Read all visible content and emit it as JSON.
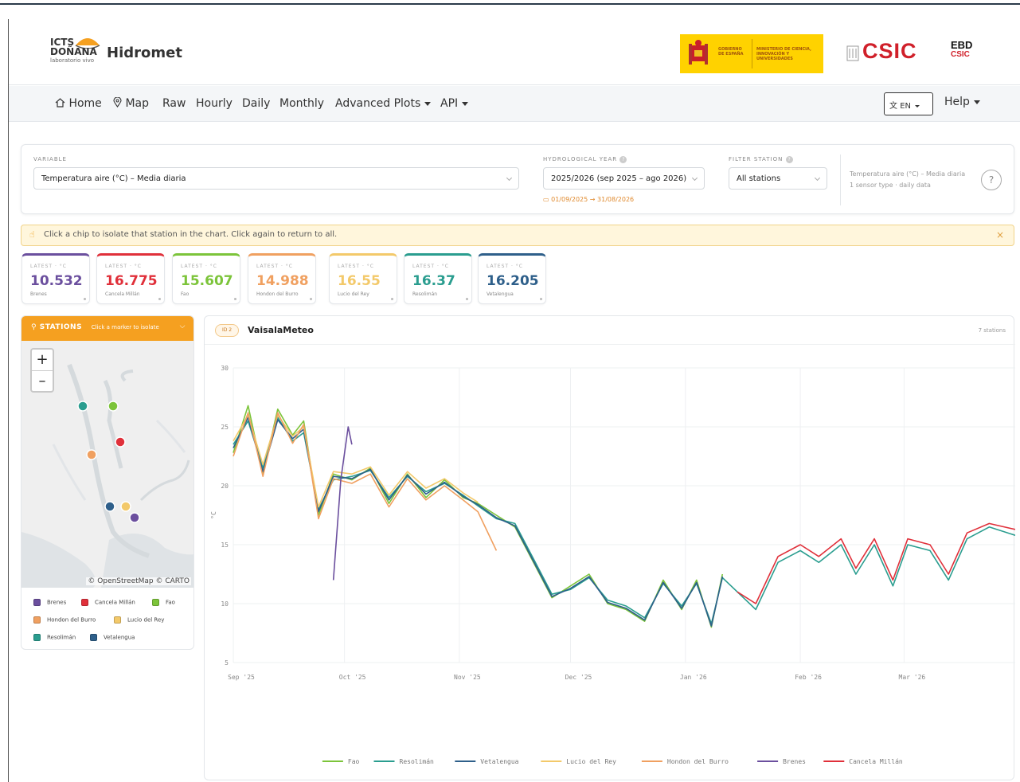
{
  "header": {
    "logo_line1": "ICTS",
    "logo_line2": "DOÑANA",
    "logo_sub": "laboratorio vivo",
    "app_title": "Hidromet",
    "gov_left": "GOBIERNO DE ESPAÑA",
    "gov_right": "MINISTERIO DE CIENCIA, INNOVACIÓN Y UNIVERSIDADES",
    "csic": "CSIC",
    "ebd": "EBD",
    "ebd_sub": "CSIC"
  },
  "nav": {
    "home": "Home",
    "map": "Map",
    "raw": "Raw",
    "hourly": "Hourly",
    "daily": "Daily",
    "monthly": "Monthly",
    "advanced": "Advanced Plots",
    "api": "API",
    "lang": "EN",
    "help": "Help"
  },
  "filters": {
    "variable_label": "VARIABLE",
    "variable_value": "Temperatura aire (°C) – Media diaria",
    "hydro_label": "HYDROLOGICAL YEAR",
    "hydro_value": "2025/2026 (sep 2025 – ago 2026)",
    "date_range": "01/09/2025 → 31/08/2026",
    "station_label": "FILTER STATION",
    "station_value": "All stations",
    "info_line1": "Temperatura aire (°C) – Media diaria",
    "info_line2": "1 sensor type · daily data",
    "info_icon": "?"
  },
  "hint": {
    "text": "Click a chip to isolate that station in the chart. Click again to return to all.",
    "close": "×"
  },
  "chips": [
    {
      "label": "LATEST · °C",
      "value": "10.532",
      "name": "Brenes",
      "color": "#6b4f9e"
    },
    {
      "label": "LATEST · °C",
      "value": "16.775",
      "name": "Cancela Millán",
      "color": "#e0303a"
    },
    {
      "label": "LATEST · °C",
      "value": "15.607",
      "name": "Fao",
      "color": "#7cc43a"
    },
    {
      "label": "LATEST · °C",
      "value": "14.988",
      "name": "Hondon del Burro",
      "color": "#f0a060"
    },
    {
      "label": "LATEST · °C",
      "value": "16.55",
      "name": "Lucio del Rey",
      "color": "#f3c96a"
    },
    {
      "label": "LATEST · °C",
      "value": "16.37",
      "name": "Resolimán",
      "color": "#2a9d8f"
    },
    {
      "label": "LATEST · °C",
      "value": "16.205",
      "name": "Vetalengua",
      "color": "#2e5f8a"
    }
  ],
  "stations_panel": {
    "title": "STATIONS",
    "subtitle": "Click a marker to isolate",
    "zoom_in": "+",
    "zoom_out": "–",
    "attribution": "© OpenStreetMap © CARTO",
    "legend": [
      {
        "name": "Brenes",
        "color": "#6b4f9e"
      },
      {
        "name": "Cancela Millán",
        "color": "#e0303a"
      },
      {
        "name": "Fao",
        "color": "#7cc43a"
      },
      {
        "name": "Hondon del Burro",
        "color": "#f0a060"
      },
      {
        "name": "Lucio del Rey",
        "color": "#f3c96a"
      },
      {
        "name": "Resolimán",
        "color": "#2a9d8f"
      },
      {
        "name": "Vetalengua",
        "color": "#2e5f8a"
      }
    ]
  },
  "chart_panel": {
    "badge": "ID 2",
    "title": "VaisalaMeteo",
    "count": "7 stations"
  },
  "chart_data": {
    "type": "line",
    "ylabel": "°C",
    "ylim": [
      5,
      30
    ],
    "yticks": [
      5,
      10,
      15,
      20,
      25,
      30
    ],
    "x_range": [
      "2025-09-01",
      "2026-03-31"
    ],
    "xticks": [
      {
        "date": "2025-09-01",
        "label": "Sep '25"
      },
      {
        "date": "2025-10-01",
        "label": "Oct '25"
      },
      {
        "date": "2025-11-01",
        "label": "Nov '25"
      },
      {
        "date": "2025-12-01",
        "label": "Dec '25"
      },
      {
        "date": "2026-01-01",
        "label": "Jan '26"
      },
      {
        "date": "2026-02-01",
        "label": "Feb '26"
      },
      {
        "date": "2026-03-01",
        "label": "Mar '26"
      }
    ],
    "legend_position": "bottom",
    "grid": true,
    "series": [
      {
        "name": "Fao",
        "color": "#7cc43a",
        "points": [
          [
            "2025-09-01",
            22.8
          ],
          [
            "2025-09-05",
            26.8
          ],
          [
            "2025-09-09",
            21.0
          ],
          [
            "2025-09-13",
            26.5
          ],
          [
            "2025-09-17",
            24.3
          ],
          [
            "2025-09-20",
            25.5
          ],
          [
            "2025-09-24",
            17.5
          ],
          [
            "2025-09-28",
            21.0
          ],
          [
            "2025-10-03",
            20.5
          ],
          [
            "2025-10-08",
            21.5
          ],
          [
            "2025-10-13",
            18.5
          ],
          [
            "2025-10-18",
            21.0
          ],
          [
            "2025-10-23",
            19.0
          ],
          [
            "2025-10-28",
            20.5
          ],
          [
            "2025-11-02",
            19.0
          ],
          [
            "2025-11-06",
            18.5
          ],
          [
            "2025-11-11",
            17.5
          ],
          [
            "2025-11-16",
            16.5
          ],
          [
            "2025-11-21",
            13.5
          ],
          [
            "2025-11-26",
            10.5
          ],
          [
            "2025-12-01",
            11.5
          ],
          [
            "2025-12-06",
            12.5
          ],
          [
            "2025-12-11",
            10.0
          ],
          [
            "2025-12-16",
            9.5
          ],
          [
            "2025-12-21",
            8.5
          ],
          [
            "2025-12-26",
            12.0
          ],
          [
            "2025-12-31",
            9.5
          ],
          [
            "2026-01-04",
            12.0
          ],
          [
            "2026-01-08",
            8.0
          ],
          [
            "2026-01-11",
            12.5
          ]
        ]
      },
      {
        "name": "Resolimán",
        "color": "#2a9d8f",
        "points": [
          [
            "2025-09-01",
            23.5
          ],
          [
            "2025-09-05",
            25.5
          ],
          [
            "2025-09-09",
            21.5
          ],
          [
            "2025-09-13",
            25.8
          ],
          [
            "2025-09-17",
            23.8
          ],
          [
            "2025-09-20",
            24.5
          ],
          [
            "2025-09-24",
            18.0
          ],
          [
            "2025-09-28",
            20.5
          ],
          [
            "2025-10-03",
            20.8
          ],
          [
            "2025-10-08",
            21.3
          ],
          [
            "2025-10-13",
            19.0
          ],
          [
            "2025-10-18",
            20.8
          ],
          [
            "2025-10-23",
            19.5
          ],
          [
            "2025-10-28",
            20.2
          ],
          [
            "2025-11-02",
            19.2
          ],
          [
            "2025-11-06",
            18.3
          ],
          [
            "2025-11-11",
            17.2
          ],
          [
            "2025-11-16",
            16.8
          ],
          [
            "2025-11-21",
            13.8
          ],
          [
            "2025-11-26",
            10.8
          ],
          [
            "2025-12-01",
            11.2
          ],
          [
            "2025-12-06",
            12.2
          ],
          [
            "2025-12-11",
            10.3
          ],
          [
            "2025-12-16",
            9.8
          ],
          [
            "2025-12-21",
            8.8
          ],
          [
            "2025-12-26",
            11.7
          ],
          [
            "2025-12-31",
            9.8
          ],
          [
            "2026-01-04",
            11.7
          ],
          [
            "2026-01-08",
            8.3
          ],
          [
            "2026-01-11",
            12.2
          ],
          [
            "2026-01-20",
            9.5
          ],
          [
            "2026-01-26",
            13.5
          ],
          [
            "2026-02-01",
            14.5
          ],
          [
            "2026-02-06",
            13.5
          ],
          [
            "2026-02-12",
            15.0
          ],
          [
            "2026-02-16",
            12.5
          ],
          [
            "2026-02-21",
            15.0
          ],
          [
            "2026-02-26",
            11.5
          ],
          [
            "2026-03-02",
            15.0
          ],
          [
            "2026-03-08",
            14.5
          ],
          [
            "2026-03-13",
            12.0
          ],
          [
            "2026-03-18",
            15.5
          ],
          [
            "2026-03-24",
            16.5
          ],
          [
            "2026-03-31",
            15.8
          ]
        ]
      },
      {
        "name": "Vetalengua",
        "color": "#2e5f8a",
        "points": [
          [
            "2025-09-01",
            23.2
          ],
          [
            "2025-09-05",
            25.8
          ],
          [
            "2025-09-09",
            21.2
          ],
          [
            "2025-09-13",
            25.6
          ],
          [
            "2025-09-17",
            24.0
          ],
          [
            "2025-09-20",
            24.8
          ],
          [
            "2025-09-24",
            17.8
          ],
          [
            "2025-09-28",
            20.8
          ],
          [
            "2025-10-03",
            20.6
          ],
          [
            "2025-10-08",
            21.4
          ],
          [
            "2025-10-13",
            18.8
          ],
          [
            "2025-10-18",
            20.9
          ],
          [
            "2025-10-23",
            19.3
          ],
          [
            "2025-10-28",
            20.3
          ],
          [
            "2025-11-02",
            19.1
          ],
          [
            "2025-11-06",
            18.4
          ],
          [
            "2025-11-11",
            17.3
          ],
          [
            "2025-11-16",
            16.6
          ],
          [
            "2025-11-21",
            13.6
          ],
          [
            "2025-11-26",
            10.6
          ],
          [
            "2025-12-01",
            11.3
          ],
          [
            "2025-12-06",
            12.3
          ],
          [
            "2025-12-11",
            10.1
          ],
          [
            "2025-12-16",
            9.6
          ],
          [
            "2025-12-21",
            8.6
          ],
          [
            "2025-12-26",
            11.8
          ],
          [
            "2025-12-31",
            9.6
          ],
          [
            "2026-01-04",
            11.8
          ],
          [
            "2026-01-08",
            8.1
          ],
          [
            "2026-01-11",
            12.3
          ]
        ]
      },
      {
        "name": "Lucio del Rey",
        "color": "#f3c96a",
        "points": [
          [
            "2025-09-01",
            23.8
          ],
          [
            "2025-09-05",
            26.0
          ],
          [
            "2025-09-09",
            21.8
          ],
          [
            "2025-09-13",
            26.0
          ],
          [
            "2025-09-17",
            24.2
          ],
          [
            "2025-09-20",
            25.0
          ],
          [
            "2025-09-24",
            18.2
          ],
          [
            "2025-09-28",
            21.2
          ],
          [
            "2025-10-03",
            21.0
          ],
          [
            "2025-10-08",
            21.6
          ],
          [
            "2025-10-13",
            19.2
          ],
          [
            "2025-10-18",
            21.2
          ],
          [
            "2025-10-23",
            19.8
          ],
          [
            "2025-10-28",
            20.6
          ],
          [
            "2025-11-02",
            19.4
          ],
          [
            "2025-11-06",
            18.6
          ]
        ]
      },
      {
        "name": "Hondon del Burro",
        "color": "#f0a060",
        "points": [
          [
            "2025-09-01",
            22.5
          ],
          [
            "2025-09-05",
            26.2
          ],
          [
            "2025-09-09",
            20.8
          ],
          [
            "2025-09-13",
            26.2
          ],
          [
            "2025-09-17",
            23.6
          ],
          [
            "2025-09-20",
            25.2
          ],
          [
            "2025-09-24",
            17.2
          ],
          [
            "2025-09-28",
            20.6
          ],
          [
            "2025-10-03",
            20.2
          ],
          [
            "2025-10-08",
            21.0
          ],
          [
            "2025-10-13",
            18.2
          ],
          [
            "2025-10-18",
            20.6
          ],
          [
            "2025-10-23",
            18.8
          ],
          [
            "2025-10-28",
            20.0
          ],
          [
            "2025-11-02",
            18.8
          ],
          [
            "2025-11-06",
            17.8
          ],
          [
            "2025-11-11",
            14.5
          ]
        ]
      },
      {
        "name": "Brenes",
        "color": "#6b4f9e",
        "points": [
          [
            "2025-09-28",
            12.0
          ],
          [
            "2025-09-30",
            20.5
          ],
          [
            "2025-10-02",
            25.0
          ],
          [
            "2025-10-03",
            23.5
          ]
        ]
      },
      {
        "name": "Cancela Millán",
        "color": "#e0303a",
        "points": [
          [
            "2026-01-15",
            11.0
          ],
          [
            "2026-01-20",
            10.0
          ],
          [
            "2026-01-26",
            14.0
          ],
          [
            "2026-02-01",
            15.0
          ],
          [
            "2026-02-06",
            14.0
          ],
          [
            "2026-02-12",
            15.5
          ],
          [
            "2026-02-16",
            13.0
          ],
          [
            "2026-02-21",
            15.5
          ],
          [
            "2026-02-26",
            12.0
          ],
          [
            "2026-03-02",
            15.5
          ],
          [
            "2026-03-08",
            15.0
          ],
          [
            "2026-03-13",
            12.5
          ],
          [
            "2026-03-18",
            16.0
          ],
          [
            "2026-03-24",
            16.8
          ],
          [
            "2026-03-31",
            16.3
          ]
        ]
      }
    ]
  }
}
